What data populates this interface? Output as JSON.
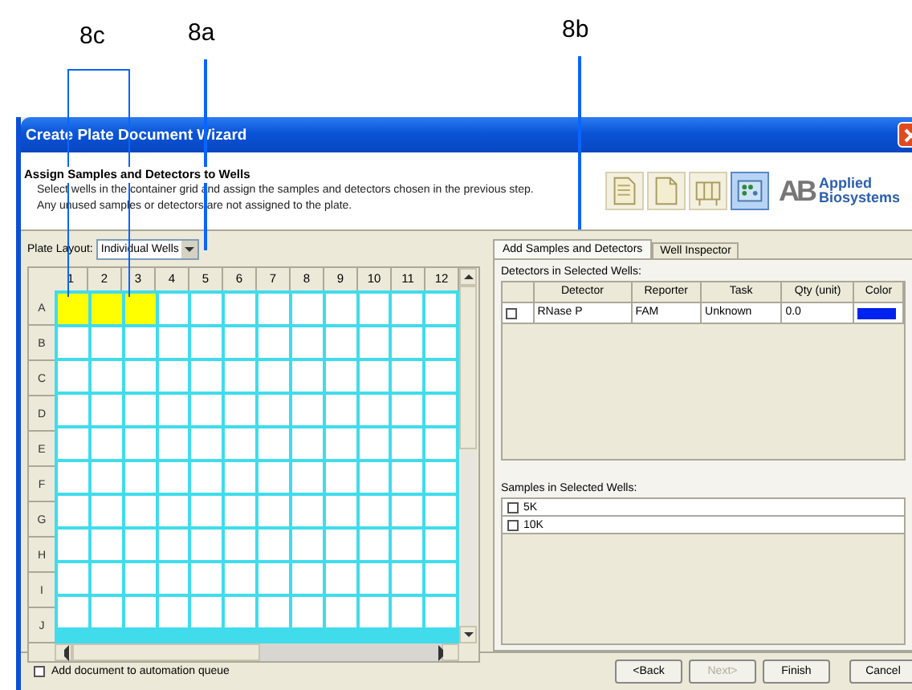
{
  "annotations": [
    {
      "label": "8c",
      "kind": "bracket"
    },
    {
      "label": "8a",
      "kind": "line"
    },
    {
      "label": "8b",
      "kind": "line"
    }
  ],
  "window": {
    "title": "Create Plate Document Wizard"
  },
  "header": {
    "title": "Assign Samples and Detectors to Wells",
    "lines": [
      "Select wells in the container grid and assign the samples and detectors chosen in the previous step.",
      "Any unused samples or detectors are not assigned to the plate."
    ],
    "toolbar": [
      {
        "selected": false
      },
      {
        "selected": false
      },
      {
        "selected": false
      },
      {
        "selected": true
      }
    ],
    "logo": {
      "mark": "AB",
      "name_lines": [
        "Applied",
        "Biosystems"
      ]
    }
  },
  "plate_layout": {
    "label": "Plate Layout:",
    "value": "Individual Wells"
  },
  "plate": {
    "columns": [
      "1",
      "2",
      "3",
      "4",
      "5",
      "6",
      "7",
      "8",
      "9",
      "10",
      "11",
      "12"
    ],
    "rows": [
      {
        "label": "A",
        "wells": [
          {
            "selected": true
          },
          {
            "selected": true
          },
          {
            "selected": true
          },
          {
            "selected": false
          },
          {
            "selected": false
          },
          {
            "selected": false
          },
          {
            "selected": false
          },
          {
            "selected": false
          },
          {
            "selected": false
          },
          {
            "selected": false
          },
          {
            "selected": false
          },
          {
            "selected": false
          }
        ]
      },
      {
        "label": "B",
        "wells": [
          {
            "selected": false
          },
          {
            "selected": false
          },
          {
            "selected": false
          },
          {
            "selected": false
          },
          {
            "selected": false
          },
          {
            "selected": false
          },
          {
            "selected": false
          },
          {
            "selected": false
          },
          {
            "selected": false
          },
          {
            "selected": false
          },
          {
            "selected": false
          },
          {
            "selected": false
          }
        ]
      },
      {
        "label": "C",
        "wells": [
          {
            "selected": false
          },
          {
            "selected": false
          },
          {
            "selected": false
          },
          {
            "selected": false
          },
          {
            "selected": false
          },
          {
            "selected": false
          },
          {
            "selected": false
          },
          {
            "selected": false
          },
          {
            "selected": false
          },
          {
            "selected": false
          },
          {
            "selected": false
          },
          {
            "selected": false
          }
        ]
      },
      {
        "label": "D",
        "wells": [
          {
            "selected": false
          },
          {
            "selected": false
          },
          {
            "selected": false
          },
          {
            "selected": false
          },
          {
            "selected": false
          },
          {
            "selected": false
          },
          {
            "selected": false
          },
          {
            "selected": false
          },
          {
            "selected": false
          },
          {
            "selected": false
          },
          {
            "selected": false
          },
          {
            "selected": false
          }
        ]
      },
      {
        "label": "E",
        "wells": [
          {
            "selected": false
          },
          {
            "selected": false
          },
          {
            "selected": false
          },
          {
            "selected": false
          },
          {
            "selected": false
          },
          {
            "selected": false
          },
          {
            "selected": false
          },
          {
            "selected": false
          },
          {
            "selected": false
          },
          {
            "selected": false
          },
          {
            "selected": false
          },
          {
            "selected": false
          }
        ]
      },
      {
        "label": "F",
        "wells": [
          {
            "selected": false
          },
          {
            "selected": false
          },
          {
            "selected": false
          },
          {
            "selected": false
          },
          {
            "selected": false
          },
          {
            "selected": false
          },
          {
            "selected": false
          },
          {
            "selected": false
          },
          {
            "selected": false
          },
          {
            "selected": false
          },
          {
            "selected": false
          },
          {
            "selected": false
          }
        ]
      },
      {
        "label": "G",
        "wells": [
          {
            "selected": false
          },
          {
            "selected": false
          },
          {
            "selected": false
          },
          {
            "selected": false
          },
          {
            "selected": false
          },
          {
            "selected": false
          },
          {
            "selected": false
          },
          {
            "selected": false
          },
          {
            "selected": false
          },
          {
            "selected": false
          },
          {
            "selected": false
          },
          {
            "selected": false
          }
        ]
      },
      {
        "label": "H",
        "wells": [
          {
            "selected": false
          },
          {
            "selected": false
          },
          {
            "selected": false
          },
          {
            "selected": false
          },
          {
            "selected": false
          },
          {
            "selected": false
          },
          {
            "selected": false
          },
          {
            "selected": false
          },
          {
            "selected": false
          },
          {
            "selected": false
          },
          {
            "selected": false
          },
          {
            "selected": false
          }
        ]
      },
      {
        "label": "I",
        "wells": [
          {
            "selected": false
          },
          {
            "selected": false
          },
          {
            "selected": false
          },
          {
            "selected": false
          },
          {
            "selected": false
          },
          {
            "selected": false
          },
          {
            "selected": false
          },
          {
            "selected": false
          },
          {
            "selected": false
          },
          {
            "selected": false
          },
          {
            "selected": false
          },
          {
            "selected": false
          }
        ]
      },
      {
        "label": "J",
        "wells": [
          {
            "selected": false
          },
          {
            "selected": false
          },
          {
            "selected": false
          },
          {
            "selected": false
          },
          {
            "selected": false
          },
          {
            "selected": false
          },
          {
            "selected": false
          },
          {
            "selected": false
          },
          {
            "selected": false
          },
          {
            "selected": false
          },
          {
            "selected": false
          },
          {
            "selected": false
          }
        ]
      }
    ]
  },
  "tabs": [
    {
      "label": "Add Samples and Detectors",
      "selected": true
    },
    {
      "label": "Well Inspector",
      "selected": false
    }
  ],
  "detectors": {
    "label": "Detectors in Selected Wells:",
    "columns": [
      "Detector",
      "Reporter",
      "Task",
      "Qty (unit)",
      "Color"
    ],
    "rows": [
      {
        "checked": false,
        "detector": "RNase P",
        "reporter": "FAM",
        "task": "Unknown",
        "qty": "0.0",
        "color": "#0022ee"
      }
    ]
  },
  "samples": {
    "label": "Samples in Selected Wells:",
    "items": [
      {
        "name": "5K",
        "checked": false
      },
      {
        "name": "10K",
        "checked": false
      }
    ]
  },
  "footer": {
    "automation": {
      "label": "Add document to automation queue",
      "checked": false
    },
    "buttons": [
      {
        "label": "<Back",
        "disabled": false
      },
      {
        "label": "Next>",
        "disabled": true
      },
      {
        "label": "Finish",
        "disabled": false
      },
      {
        "label": "Cancel",
        "disabled": false
      }
    ]
  }
}
